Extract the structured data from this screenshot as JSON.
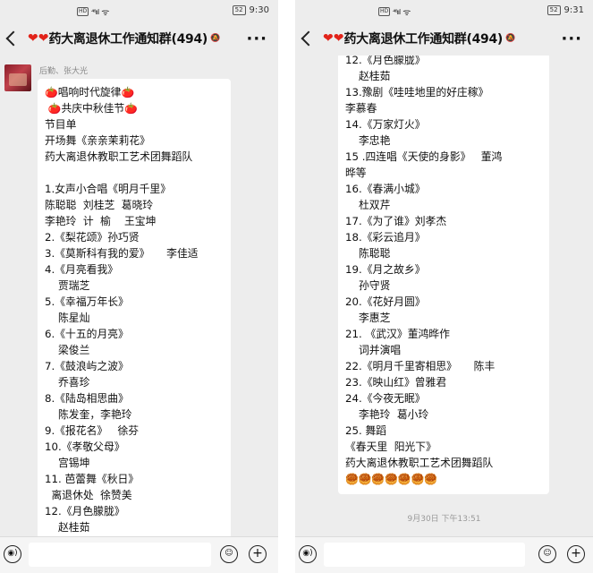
{
  "status_bar": {
    "left_time": "9:30",
    "right_time": "9:31",
    "network": "HD",
    "signal": "⁴⁶ııl",
    "wifi": "ᯤ",
    "battery": "52"
  },
  "chat": {
    "hearts": "❤❤",
    "title": "药大离退休工作通知群(494)",
    "more": "···"
  },
  "left": {
    "sender": "后勤、张大光",
    "lines": [
      "🍅唱响时代旋律🍅",
      " 🍅共庆中秋佳节🍅",
      "节目单",
      "开场舞《亲亲茉莉花》",
      "药大离退休教职工艺术团舞蹈队",
      "",
      "1.女声小合唱《明月千里》",
      "陈聪聪  刘桂芝  葛晓玲",
      "李艳玲  计  榆    王宝坤",
      "2.《梨花颂》孙巧贤",
      "3.《莫斯科有我的爱》     李佳适",
      "4.《月亮看我》",
      "    贾瑞芝",
      "5.《幸福万年长》",
      "    陈星灿",
      "6.《十五的月亮》",
      "    梁俊兰",
      "7.《鼓浪屿之波》",
      "    乔喜珍",
      "8.《陆岛相思曲》",
      "    陈发奎，李艳玲",
      "9.《报花名》   徐芬",
      "10.《孝敬父母》",
      "    宫锡坤",
      "11. 芭蕾舞《秋日》",
      "  离退休处  徐赞美",
      "12.《月色朦胧》",
      "    赵桂茹"
    ]
  },
  "right": {
    "lines": [
      "12.《月色朦胧》",
      "    赵桂茹",
      "13.豫剧《哇哇地里的好庄稼》",
      "李慕春",
      "14.《万家灯火》",
      "    李忠艳",
      "15 .四连唱《天使的身影》   董鸿",
      "晔等",
      "16.《春满小城》",
      "    杜双芹",
      "17.《为了谁》刘孝杰",
      "18.《彩云追月》",
      "    陈聪聪",
      "19.《月之故乡》",
      "    孙守贤",
      "20.《花好月圆》",
      "    李惠芝",
      "21. 《武汉》董鸿晔作",
      "    词并演唱",
      "22.《明月千里寄相思》     陈丰",
      "23.《映山红》曾雅君",
      "24.《今夜无眠》",
      "    李艳玲  葛小玲",
      "25. 舞蹈",
      "《春天里  阳光下》",
      "药大离退休教职工艺术团舞蹈队",
      "🥮🥮🥮🥮🥮🥮🥮"
    ],
    "timestamp": "9月30日 下午13:51"
  },
  "input_bar": {
    "voice": "◉)",
    "emoji": "☺",
    "plus": "+"
  }
}
